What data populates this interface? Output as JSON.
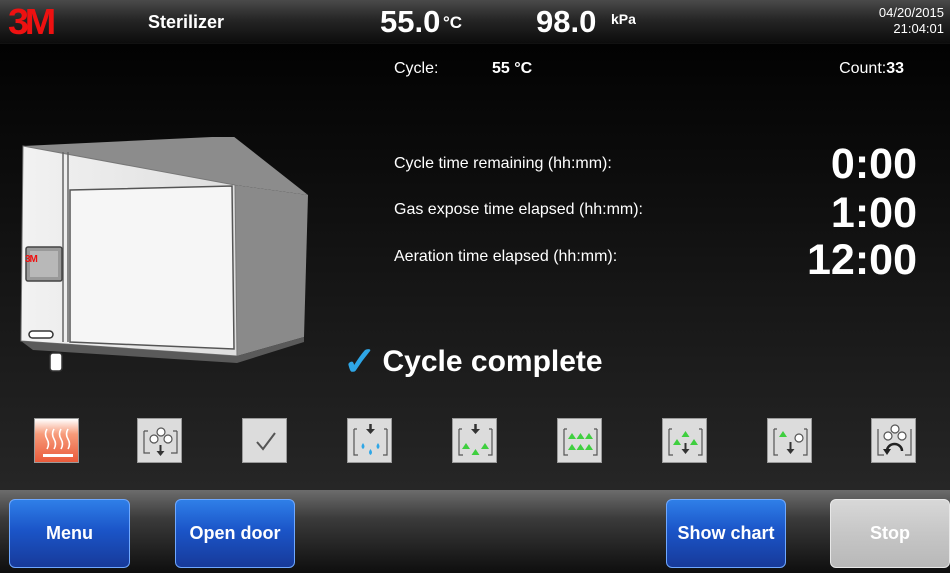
{
  "header": {
    "logo": "3M",
    "title": "Sterilizer",
    "temperature": "55.0",
    "temperature_unit": "°C",
    "pressure": "98.0",
    "pressure_unit": "kPa",
    "date": "04/20/2015",
    "time": "21:04:01"
  },
  "cycle": {
    "label": "Cycle:",
    "value": "55 °C",
    "count_label": "Count:",
    "count_value": "33"
  },
  "device": {
    "brand_mark": "3M"
  },
  "timers": [
    {
      "label": "Cycle time remaining (hh:mm):",
      "value": "0:00"
    },
    {
      "label": "Gas expose time elapsed (hh:mm):",
      "value": "1:00"
    },
    {
      "label": "Aeration time elapsed (hh:mm):",
      "value": "12:00"
    }
  ],
  "status": {
    "icon": "checkmark-icon",
    "message": "Cycle complete",
    "color": "#2ea6e6"
  },
  "steps": [
    {
      "name": "heat",
      "icon": "heat-waves-icon",
      "active": true
    },
    {
      "name": "load",
      "icon": "circles-down-arrow-icon",
      "active": false
    },
    {
      "name": "check",
      "icon": "checkmark-icon",
      "active": false
    },
    {
      "name": "humidify",
      "icon": "water-drops-icon",
      "active": false
    },
    {
      "name": "gas-inject",
      "icon": "gas-inject-icon",
      "active": false
    },
    {
      "name": "expose",
      "icon": "gas-triangles-icon",
      "active": false
    },
    {
      "name": "evacuate",
      "icon": "gas-down-arrow-icon",
      "active": false
    },
    {
      "name": "exhaust",
      "icon": "exhaust-circle-icon",
      "active": false
    },
    {
      "name": "aerate",
      "icon": "circles-cycle-icon",
      "active": false
    }
  ],
  "footer": {
    "menu": "Menu",
    "open_door": "Open door",
    "show_chart": "Show chart",
    "stop": "Stop"
  },
  "colors": {
    "accent_blue": "#1b55c8",
    "check_blue": "#2ea6e6",
    "active_step": "#ea5a3a",
    "brand_red": "#e11111",
    "gas_green": "#3fcf3f"
  }
}
